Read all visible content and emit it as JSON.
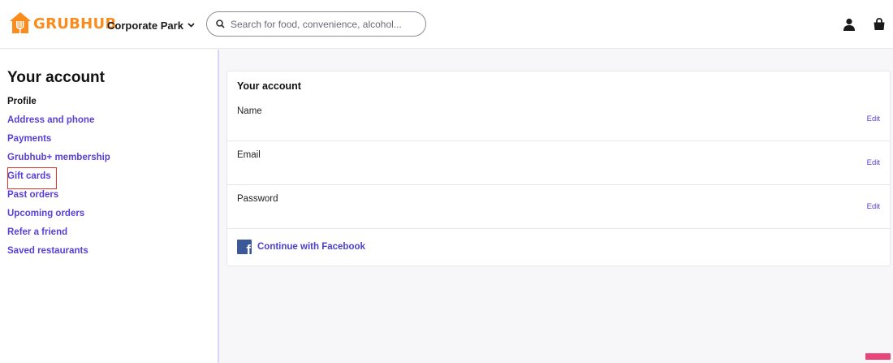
{
  "header": {
    "logo_text": "GRUBHUB",
    "location_label": "Corporate Park",
    "search_placeholder": "Search for food, convenience, alcohol...",
    "icons": [
      "user-icon",
      "shopping-bag-icon",
      "chevron-down-icon",
      "search-icon"
    ]
  },
  "sidebar": {
    "title": "Your account",
    "items": [
      {
        "label": "Profile",
        "active": true
      },
      {
        "label": "Address and phone"
      },
      {
        "label": "Payments"
      },
      {
        "label": "Grubhub+ membership"
      },
      {
        "label": "Gift cards",
        "highlighted": true
      },
      {
        "label": "Past orders"
      },
      {
        "label": "Upcoming orders"
      },
      {
        "label": "Refer a friend"
      },
      {
        "label": "Saved restaurants"
      }
    ]
  },
  "account_card": {
    "title": "Your account",
    "rows": [
      {
        "label": "Name",
        "action": "Edit"
      },
      {
        "label": "Email",
        "action": "Edit"
      },
      {
        "label": "Password",
        "action": "Edit"
      }
    ],
    "facebook_label": "Continue with Facebook"
  },
  "colors": {
    "brand_orange": "#f98c1c",
    "link_purple": "#5a3fd6",
    "facebook_blue": "#3b5998",
    "highlight_red": "#e0312b"
  }
}
